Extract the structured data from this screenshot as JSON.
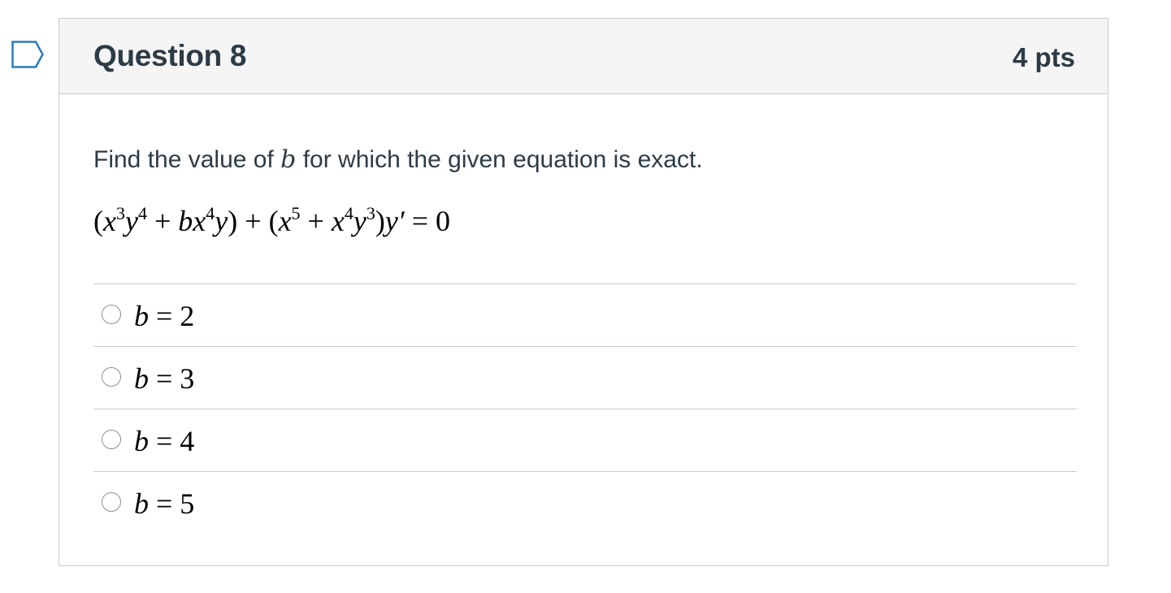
{
  "question": {
    "title": "Question 8",
    "points": "4 pts",
    "prompt_before": "Find the value of ",
    "prompt_var": "b",
    "prompt_after": " for which the given equation is exact.",
    "equation": {
      "paren_open1": "(",
      "x1": "x",
      "x1_exp": "3",
      "y1": "y",
      "y1_exp": "4",
      "plus1": " + ",
      "b": "b",
      "x2": "x",
      "x2_exp": "4",
      "y2": "y",
      "paren_close1": ")",
      "plus2": " + ",
      "paren_open2": "(",
      "x3": "x",
      "x3_exp": "5",
      "plus3": " + ",
      "x4": "x",
      "x4_exp": "4",
      "y4": "y",
      "y4_exp": "3",
      "paren_close2": ")",
      "yprime": "y′",
      "equals": " = 0"
    }
  },
  "answers": [
    {
      "var": "b",
      "rest": " = 2"
    },
    {
      "var": "b",
      "rest": " = 3"
    },
    {
      "var": "b",
      "rest": " = 4"
    },
    {
      "var": "b",
      "rest": " = 5"
    }
  ],
  "icons": {
    "flag": "bookmark-flag-icon",
    "radio": "radio-button"
  },
  "colors": {
    "header_bg": "#f5f5f5",
    "border": "#c7cdd1",
    "text": "#2d3b45",
    "flag_stroke": "#2b7abc"
  }
}
